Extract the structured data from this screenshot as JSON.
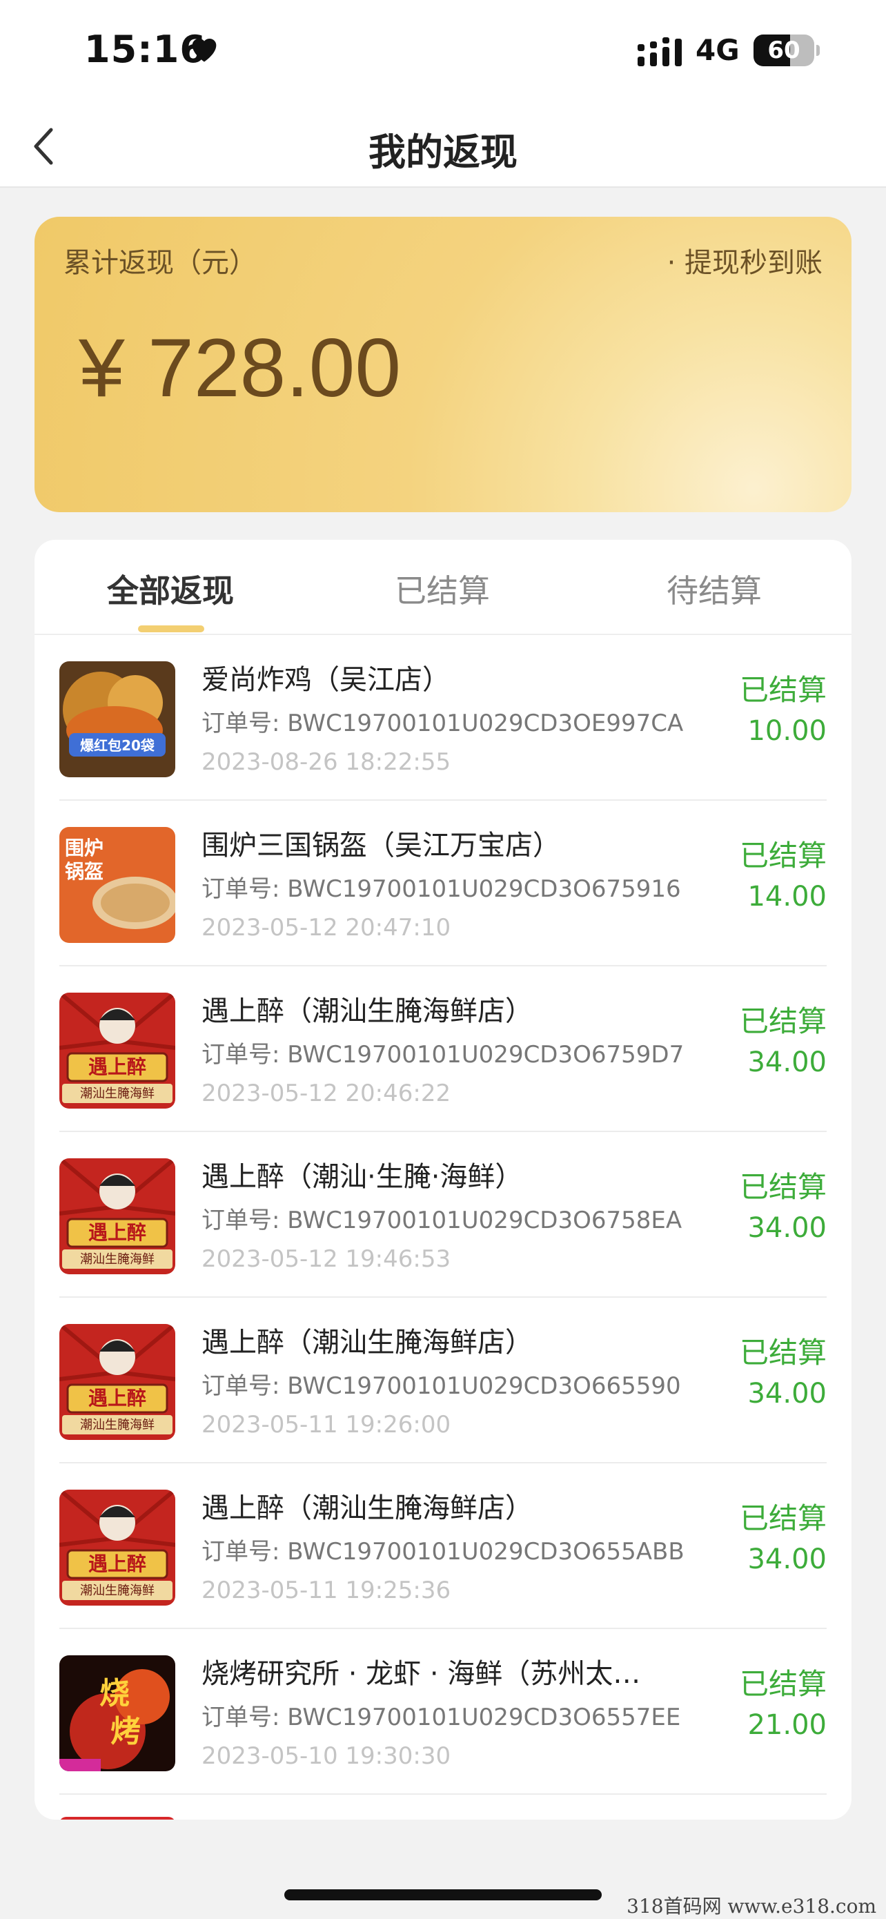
{
  "status_bar": {
    "time": "15:16",
    "network": "4G",
    "battery_level": "60",
    "battery_fraction": 0.6
  },
  "nav": {
    "title": "我的返现"
  },
  "summary": {
    "label": "累计返现（元）",
    "withdraw_note": "· 提现秒到账",
    "amount": "¥ 728.00"
  },
  "tabs": [
    {
      "label": "全部返现"
    },
    {
      "label": "已结算"
    },
    {
      "label": "待结算"
    }
  ],
  "orders": [
    {
      "store": "爱尚炸鸡（吴江店）",
      "order_no": "订单号: BWC19700101U029CD3OE997CA",
      "time": "2023-08-26 18:22:55",
      "status": "已结算",
      "amount": "10.00",
      "thumb": {
        "kind": "food",
        "caption": "爆红包20袋"
      }
    },
    {
      "store": "围炉三国锅盔（吴江万宝店）",
      "order_no": "订单号: BWC19700101U029CD3O675916",
      "time": "2023-05-12 20:47:10",
      "status": "已结算",
      "amount": "14.00",
      "thumb": {
        "kind": "guokui",
        "caption": "围炉锅盔"
      }
    },
    {
      "store": "遇上醉（潮汕生腌海鲜店）",
      "order_no": "订单号: BWC19700101U029CD3O6759D7",
      "time": "2023-05-12 20:46:22",
      "status": "已结算",
      "amount": "34.00",
      "thumb": {
        "kind": "opera",
        "caption": "遇上醉",
        "sub": "潮汕生腌海鲜"
      }
    },
    {
      "store": "遇上醉（潮汕·生腌·海鲜）",
      "order_no": "订单号: BWC19700101U029CD3O6758EA",
      "time": "2023-05-12 19:46:53",
      "status": "已结算",
      "amount": "34.00",
      "thumb": {
        "kind": "opera",
        "caption": "遇上醉",
        "sub": "潮汕生腌海鲜"
      }
    },
    {
      "store": "遇上醉（潮汕生腌海鲜店）",
      "order_no": "订单号: BWC19700101U029CD3O665590",
      "time": "2023-05-11 19:26:00",
      "status": "已结算",
      "amount": "34.00",
      "thumb": {
        "kind": "opera",
        "caption": "遇上醉",
        "sub": "潮汕生腌海鲜"
      }
    },
    {
      "store": "遇上醉（潮汕生腌海鲜店）",
      "order_no": "订单号: BWC19700101U029CD3O655ABB",
      "time": "2023-05-11 19:25:36",
      "status": "已结算",
      "amount": "34.00",
      "thumb": {
        "kind": "opera",
        "caption": "遇上醉",
        "sub": "潮汕生腌海鲜"
      }
    },
    {
      "store": "烧烤研究所 · 龙虾 · 海鲜（苏州太…",
      "order_no": "订单号: BWC19700101U029CD3O6557EE",
      "time": "2023-05-10 19:30:30",
      "status": "已结算",
      "amount": "21.00",
      "thumb": {
        "kind": "bbq",
        "caption": "烧烤"
      }
    }
  ],
  "watermark": "318首码网  www.e318.com",
  "colors": {
    "accent_gold": "#f0c968",
    "settled_green": "#3dac3a",
    "tab_indicator": "#f3cf72"
  }
}
